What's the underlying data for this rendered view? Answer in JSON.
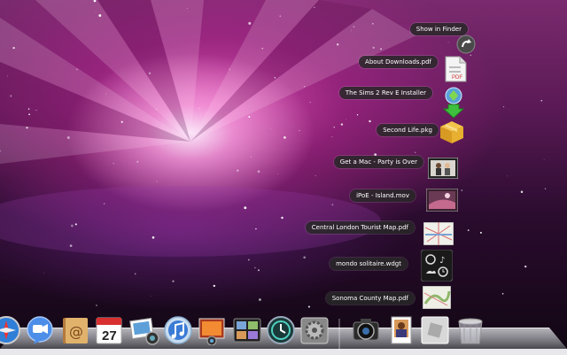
{
  "stack": {
    "items": [
      {
        "label": "Show in Finder",
        "icon": "arrow-circle-icon"
      },
      {
        "label": "About Downloads.pdf",
        "icon": "pdf-document-icon"
      },
      {
        "label": "The Sims 2 Rev E Installer",
        "icon": "sims-installer-icon"
      },
      {
        "label": "Second Life.pkg",
        "icon": "package-icon"
      },
      {
        "label": "Get a Mac - Party is Over",
        "icon": "video-thumbnail-icon"
      },
      {
        "label": "iPoE - Island.mov",
        "icon": "movie-thumbnail-icon"
      },
      {
        "label": "Central London Tourist Map.pdf",
        "icon": "map-pdf-icon"
      },
      {
        "label": "mondo solitaire.wdgt",
        "icon": "widget-icon"
      },
      {
        "label": "Sonoma County Map.pdf",
        "icon": "map-pdf-icon"
      }
    ]
  },
  "dock": {
    "apps": [
      {
        "name": "safari-icon"
      },
      {
        "name": "ichat-icon"
      },
      {
        "name": "address-book-icon"
      },
      {
        "name": "ical-icon",
        "text": "27"
      },
      {
        "name": "iphoto-icon"
      },
      {
        "name": "itunes-icon"
      },
      {
        "name": "photo-booth-icon"
      },
      {
        "name": "spaces-icon"
      },
      {
        "name": "time-machine-icon"
      },
      {
        "name": "system-preferences-icon"
      },
      {
        "name": "aperture-icon"
      },
      {
        "name": "preview-icon"
      },
      {
        "name": "downloads-stack-icon"
      },
      {
        "name": "trash-icon"
      }
    ]
  },
  "colors": {
    "label_bg": "#2a2a2a",
    "accent_pink": "#e458be"
  }
}
